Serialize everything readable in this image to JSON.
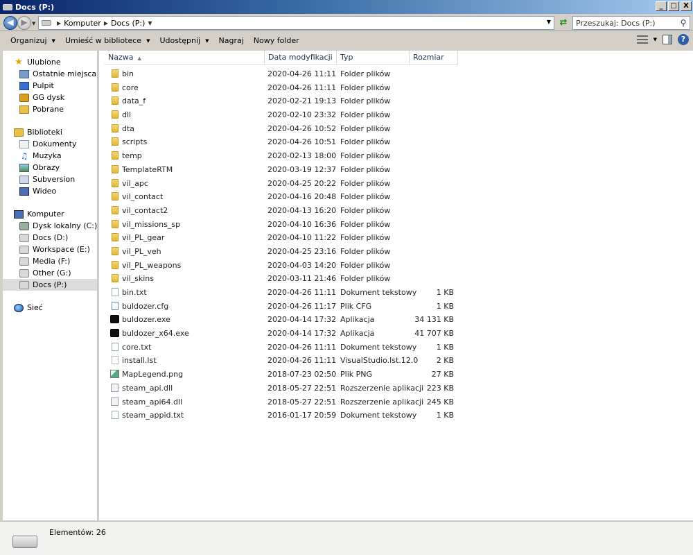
{
  "window": {
    "title": "Docs (P:)"
  },
  "window_controls": {
    "minimize": "_",
    "maximize": "□",
    "close": "X"
  },
  "address": {
    "crumbs": [
      "Komputer",
      "Docs (P:)"
    ]
  },
  "search": {
    "placeholder": "Przeszukaj: Docs (P:)"
  },
  "toolbar": {
    "organize": "Organizuj",
    "library": "Umieść w bibliotece",
    "share": "Udostępnij",
    "burn": "Nagraj",
    "new_folder": "Nowy folder"
  },
  "nav": {
    "favorites": {
      "label": "Ulubione",
      "items": [
        "Ostatnie miejsca",
        "Pulpit",
        "GG dysk",
        "Pobrane"
      ]
    },
    "libraries": {
      "label": "Biblioteki",
      "items": [
        "Dokumenty",
        "Muzyka",
        "Obrazy",
        "Subversion",
        "Wideo"
      ]
    },
    "computer": {
      "label": "Komputer",
      "items": [
        "Dysk lokalny (C:)",
        "Docs (D:)",
        "Workspace (E:)",
        "Media (F:)",
        "Other (G:)",
        "Docs (P:)"
      ]
    },
    "network": {
      "label": "Sieć"
    }
  },
  "columns": {
    "name": "Nazwa",
    "date": "Data modyfikacji",
    "type": "Typ",
    "size": "Rozmiar"
  },
  "files": [
    {
      "name": "bin",
      "date": "2020-04-26 11:11",
      "type": "Folder plików",
      "size": "",
      "icon": "folder"
    },
    {
      "name": "core",
      "date": "2020-04-26 11:11",
      "type": "Folder plików",
      "size": "",
      "icon": "folder"
    },
    {
      "name": "data_f",
      "date": "2020-02-21 19:13",
      "type": "Folder plików",
      "size": "",
      "icon": "folder"
    },
    {
      "name": "dll",
      "date": "2020-02-10 23:32",
      "type": "Folder plików",
      "size": "",
      "icon": "folder"
    },
    {
      "name": "dta",
      "date": "2020-04-26 10:52",
      "type": "Folder plików",
      "size": "",
      "icon": "folder"
    },
    {
      "name": "scripts",
      "date": "2020-04-26 10:51",
      "type": "Folder plików",
      "size": "",
      "icon": "folder"
    },
    {
      "name": "temp",
      "date": "2020-02-13 18:00",
      "type": "Folder plików",
      "size": "",
      "icon": "folder"
    },
    {
      "name": "TemplateRTM",
      "date": "2020-03-19 12:37",
      "type": "Folder plików",
      "size": "",
      "icon": "folder"
    },
    {
      "name": "vil_apc",
      "date": "2020-04-25 20:22",
      "type": "Folder plików",
      "size": "",
      "icon": "folder"
    },
    {
      "name": "vil_contact",
      "date": "2020-04-16 20:48",
      "type": "Folder plików",
      "size": "",
      "icon": "folder"
    },
    {
      "name": "vil_contact2",
      "date": "2020-04-13 16:20",
      "type": "Folder plików",
      "size": "",
      "icon": "folder"
    },
    {
      "name": "vil_missions_sp",
      "date": "2020-04-10 16:36",
      "type": "Folder plików",
      "size": "",
      "icon": "folder"
    },
    {
      "name": "vil_PL_gear",
      "date": "2020-04-10 11:22",
      "type": "Folder plików",
      "size": "",
      "icon": "folder"
    },
    {
      "name": "vil_PL_veh",
      "date": "2020-04-25 23:16",
      "type": "Folder plików",
      "size": "",
      "icon": "folder"
    },
    {
      "name": "vil_PL_weapons",
      "date": "2020-04-03 14:20",
      "type": "Folder plików",
      "size": "",
      "icon": "folder"
    },
    {
      "name": "vil_skins",
      "date": "2020-03-11 21:46",
      "type": "Folder plików",
      "size": "",
      "icon": "folder"
    },
    {
      "name": "bin.txt",
      "date": "2020-04-26 11:11",
      "type": "Dokument tekstowy",
      "size": "1 KB",
      "icon": "text"
    },
    {
      "name": "buldozer.cfg",
      "date": "2020-04-26 11:17",
      "type": "Plik CFG",
      "size": "1 KB",
      "icon": "cfg"
    },
    {
      "name": "buldozer.exe",
      "date": "2020-04-14 17:32",
      "type": "Aplikacja",
      "size": "34 131 KB",
      "icon": "exe"
    },
    {
      "name": "buldozer_x64.exe",
      "date": "2020-04-14 17:32",
      "type": "Aplikacja",
      "size": "41 707 KB",
      "icon": "exe"
    },
    {
      "name": "core.txt",
      "date": "2020-04-26 11:11",
      "type": "Dokument tekstowy",
      "size": "1 KB",
      "icon": "text"
    },
    {
      "name": "install.lst",
      "date": "2020-04-26 11:11",
      "type": "VisualStudio.lst.12.0",
      "size": "2 KB",
      "icon": "lst"
    },
    {
      "name": "MapLegend.png",
      "date": "2018-07-23 02:50",
      "type": "Plik PNG",
      "size": "27 KB",
      "icon": "png"
    },
    {
      "name": "steam_api.dll",
      "date": "2018-05-27 22:51",
      "type": "Rozszerzenie aplikacji",
      "size": "223 KB",
      "icon": "dll"
    },
    {
      "name": "steam_api64.dll",
      "date": "2018-05-27 22:51",
      "type": "Rozszerzenie aplikacji",
      "size": "245 KB",
      "icon": "dll"
    },
    {
      "name": "steam_appid.txt",
      "date": "2016-01-17 20:59",
      "type": "Dokument tekstowy",
      "size": "1 KB",
      "icon": "text"
    }
  ],
  "status": {
    "items_text": "Elementów: 26"
  }
}
